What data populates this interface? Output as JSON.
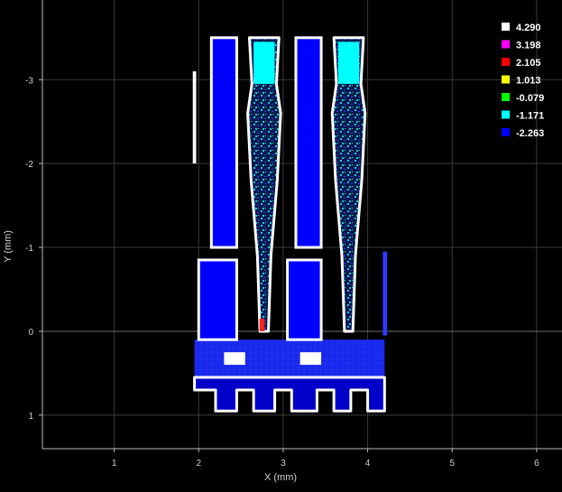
{
  "chart_data": {
    "type": "heatmap",
    "xlabel": "X (mm)",
    "ylabel": "Y (mm)",
    "xlim": [
      0.15,
      6.3
    ],
    "ylim": [
      1.4,
      -3.95
    ],
    "x_ticks": [
      "1",
      "2",
      "3",
      "4",
      "5",
      "6"
    ],
    "y_ticks": [
      "-3",
      "-2",
      "-1",
      "0",
      "1"
    ],
    "grid": true,
    "legend_placement": "top-right",
    "colorbar": [
      {
        "value": "4.290",
        "color": "#ffffff"
      },
      {
        "value": "3.198",
        "color": "#ff00ff"
      },
      {
        "value": "2.105",
        "color": "#ff0000"
      },
      {
        "value": "1.013",
        "color": "#ffff00"
      },
      {
        "value": "-0.079",
        "color": "#00ff00"
      },
      {
        "value": "-1.171",
        "color": "#00ffff"
      },
      {
        "value": "-2.263",
        "color": "#0000ff"
      }
    ],
    "regions": [
      {
        "label": "left electrode column",
        "x": [
          2.15,
          2.45
        ],
        "y": [
          -3.5,
          -1.0
        ],
        "level": "-2.263"
      },
      {
        "label": "right electrode column",
        "x": [
          3.15,
          3.45
        ],
        "y": [
          -3.5,
          -1.0
        ],
        "level": "-2.263"
      },
      {
        "label": "left cavity",
        "x": [
          2.6,
          2.95
        ],
        "y": [
          -3.5,
          0.0
        ],
        "level": "-1.171"
      },
      {
        "label": "right cavity",
        "x": [
          3.6,
          3.95
        ],
        "y": [
          -3.5,
          0.0
        ],
        "level": "-1.171"
      },
      {
        "label": "left base block",
        "x": [
          2.0,
          2.45
        ],
        "y": [
          -0.85,
          0.1
        ],
        "level": "-2.263"
      },
      {
        "label": "right base block",
        "x": [
          3.05,
          3.45
        ],
        "y": [
          -0.85,
          0.1
        ],
        "level": "-2.263"
      },
      {
        "label": "bottom band",
        "x": [
          1.95,
          4.2
        ],
        "y": [
          0.1,
          0.55
        ],
        "level": "-2.263"
      },
      {
        "label": "comb teeth",
        "x": [
          1.95,
          4.2
        ],
        "y": [
          0.55,
          0.95
        ],
        "level": "4.290"
      }
    ]
  }
}
